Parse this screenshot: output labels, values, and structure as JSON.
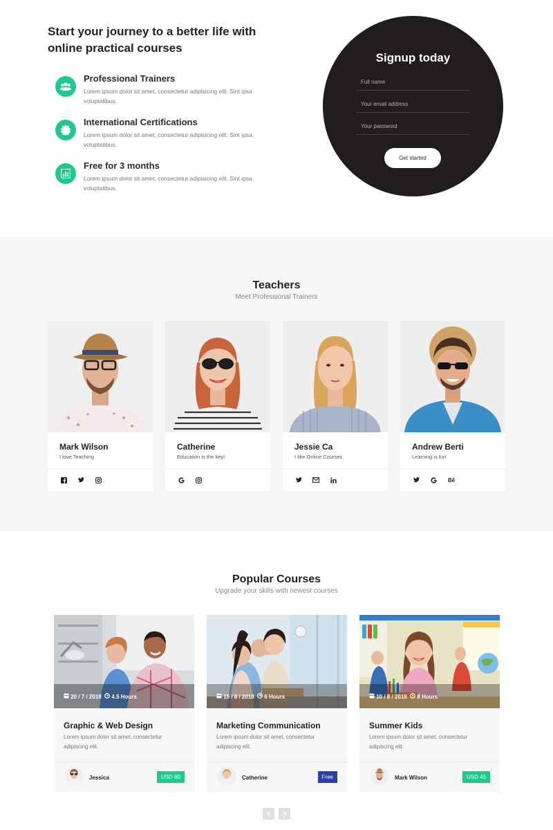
{
  "hero": {
    "title": "Start your journey to a better life with online practical courses",
    "features": [
      {
        "title": "Professional Trainers",
        "desc": "Lorem ipsum dolor sit amet, consectetur adipisicing elit. Sint ipsa voluptatibus.",
        "icon": "users-icon"
      },
      {
        "title": "International Certifications",
        "desc": "Lorem ipsum dolor sit amet, consectetur adipisicing elit. Sint ipsa voluptatibus.",
        "icon": "badge-icon"
      },
      {
        "title": "Free for 3 months",
        "desc": "Lorem ipsum dolor sit amet, consectetur adipisicing elit. Sint ipsa voluptatibus.",
        "icon": "chart-icon"
      }
    ],
    "accent_color": "#1fc98c"
  },
  "signup": {
    "title": "Signup today",
    "fullname_placeholder": "Full name",
    "email_placeholder": "Your email address",
    "password_placeholder": "Your password",
    "button_label": "Get started",
    "bg_color": "#211d1d"
  },
  "teachers": {
    "title": "Teachers",
    "subtitle": "Meet Professional Trainers",
    "items": [
      {
        "name": "Mark Wilson",
        "tagline": "I love Teaching",
        "social": [
          "facebook-icon",
          "twitter-icon",
          "instagram-icon"
        ]
      },
      {
        "name": "Catherine",
        "tagline": "Education is the key!",
        "social": [
          "google-icon",
          "instagram-icon"
        ]
      },
      {
        "name": "Jessie Ca",
        "tagline": "I like Online Courses",
        "social": [
          "twitter-icon",
          "mail-icon",
          "linkedin-icon"
        ]
      },
      {
        "name": "Andrew Berti",
        "tagline": "Learning is fun",
        "social": [
          "twitter-icon",
          "google-icon",
          "behance-icon"
        ]
      }
    ]
  },
  "courses": {
    "title": "Popular Courses",
    "subtitle": "Upgrade your skills with newest courses",
    "items": [
      {
        "date": "20 / 7 / 2018",
        "duration": "4.5 Hours",
        "title": "Graphic & Web Design",
        "desc": "Lorem ipsum dolor sit amet, consectetur adipiscing elit.",
        "author": "Jessica",
        "price": "USD 80",
        "price_color": "#1fc98c"
      },
      {
        "date": "15 / 8 / 2018",
        "duration": "6 Hours",
        "title": "Marketing Communication",
        "desc": "Lorem ipsum dolor sit amet, consectetur adipiscing elit.",
        "author": "Catherine",
        "price": "Free",
        "price_color": "#2c3fa8"
      },
      {
        "date": "10 / 8 / 2018",
        "duration": "8 Hours",
        "title": "Summer Kids",
        "desc": "Lorem ipsum dolor sit amet, consectetur adipiscing elit.",
        "author": "Mark Wilson",
        "price": "USD 45",
        "price_color": "#1fc98c"
      }
    ],
    "prev_icon": "chevron-left-icon",
    "next_icon": "chevron-right-icon"
  }
}
